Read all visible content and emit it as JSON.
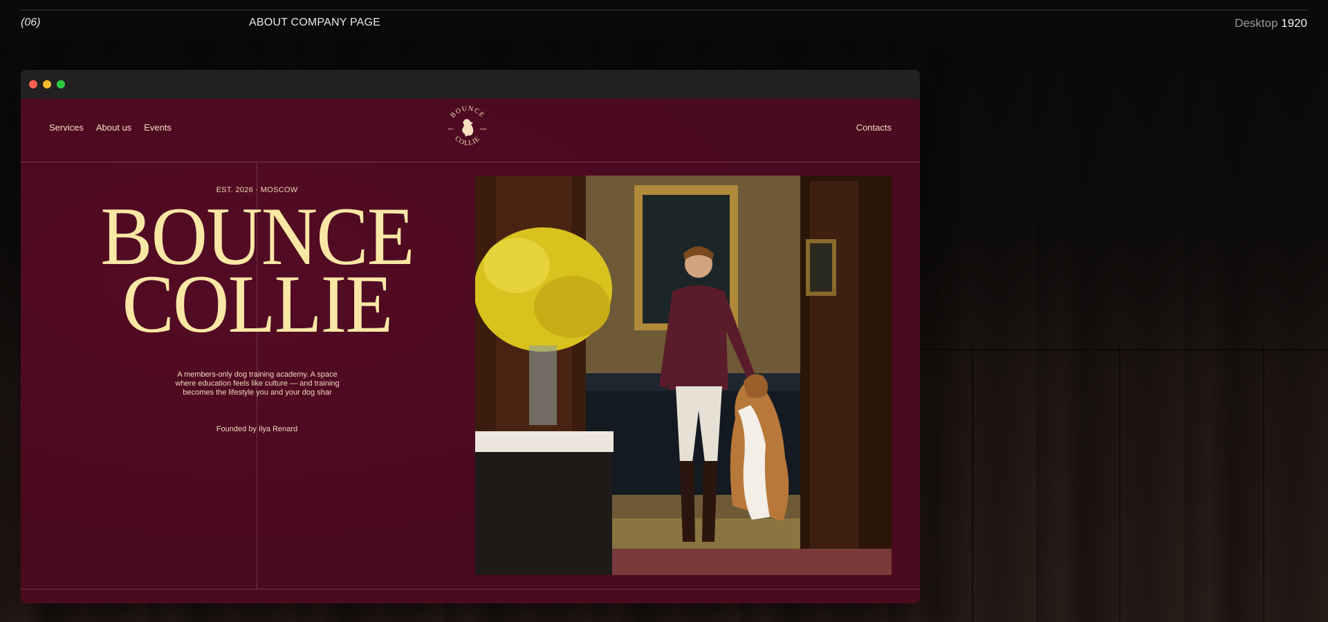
{
  "header": {
    "number": "(06)",
    "title": "ABOUT COMPANY PAGE",
    "device_prefix": "Desktop",
    "device_value": "1920"
  },
  "nav": {
    "items": [
      "Services",
      "About us",
      "Events"
    ],
    "contacts": "Contacts"
  },
  "logo": {
    "top_text": "BOUNCE",
    "bottom_text": "COLLIE",
    "left_text": "EST.",
    "right_text": "2026"
  },
  "hero": {
    "est_line": "EST. 2026 · MOSCOW",
    "title_line1": "BOUNCE",
    "title_line2": "COLLIE",
    "description": "A members-only dog training academy. A space where education feels like culture — and training becomes the lifestyle you and your dog shar",
    "founded": "Founded by Ilya Renard"
  },
  "colors": {
    "site_bg": "#4a0a1f",
    "title_color": "#fbe7a5",
    "text_color": "#f4d9bf"
  },
  "icons": {
    "logo": "collie-dog-emblem",
    "window_controls": [
      "close-dot",
      "minimize-dot",
      "maximize-dot"
    ]
  }
}
